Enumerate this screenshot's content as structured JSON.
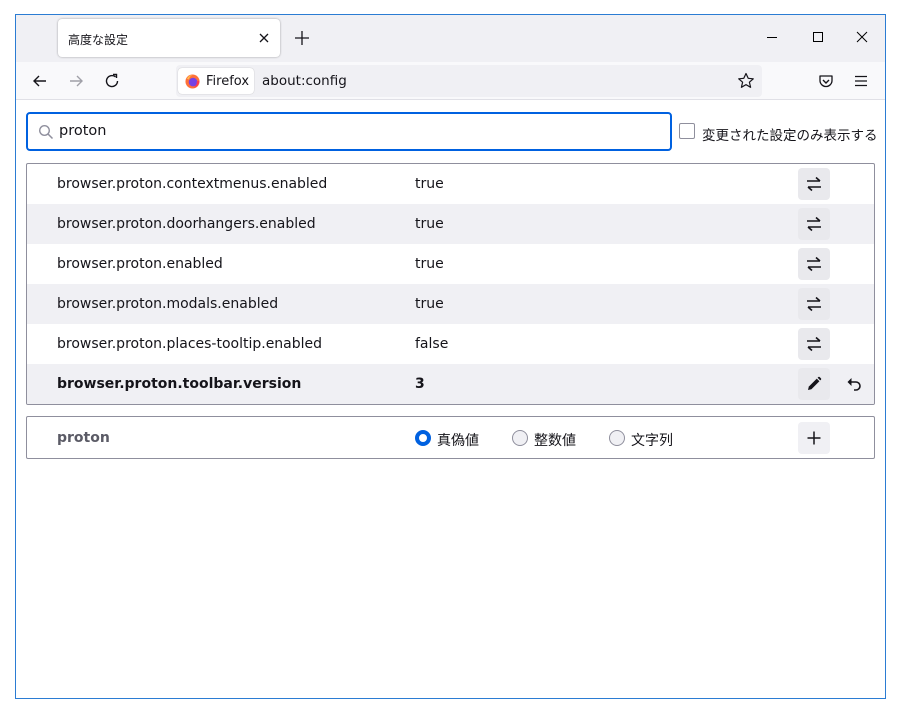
{
  "tab": {
    "title": "高度な設定"
  },
  "urlbar": {
    "identity_label": "Firefox",
    "url": "about:config"
  },
  "search": {
    "value": "proton"
  },
  "filter": {
    "modified_only_label": "変更された設定のみ表示する",
    "checked": false
  },
  "prefs": [
    {
      "name": "browser.proton.contextmenus.enabled",
      "value": "true",
      "modified": false,
      "action": "toggle"
    },
    {
      "name": "browser.proton.doorhangers.enabled",
      "value": "true",
      "modified": false,
      "action": "toggle"
    },
    {
      "name": "browser.proton.enabled",
      "value": "true",
      "modified": false,
      "action": "toggle"
    },
    {
      "name": "browser.proton.modals.enabled",
      "value": "true",
      "modified": false,
      "action": "toggle"
    },
    {
      "name": "browser.proton.places-tooltip.enabled",
      "value": "false",
      "modified": false,
      "action": "toggle"
    },
    {
      "name": "browser.proton.toolbar.version",
      "value": "3",
      "modified": true,
      "action": "edit"
    }
  ],
  "add_row": {
    "name": "proton",
    "types": [
      {
        "label": "真偽値",
        "selected": true
      },
      {
        "label": "整数値",
        "selected": false
      },
      {
        "label": "文字列",
        "selected": false
      }
    ]
  },
  "icons": {
    "toggle": "swap-arrows-icon",
    "edit": "pencil-icon",
    "reset": "undo-icon",
    "add": "plus-icon"
  },
  "colors": {
    "accent": "#0061e0",
    "window_border": "#2b7cd3"
  }
}
